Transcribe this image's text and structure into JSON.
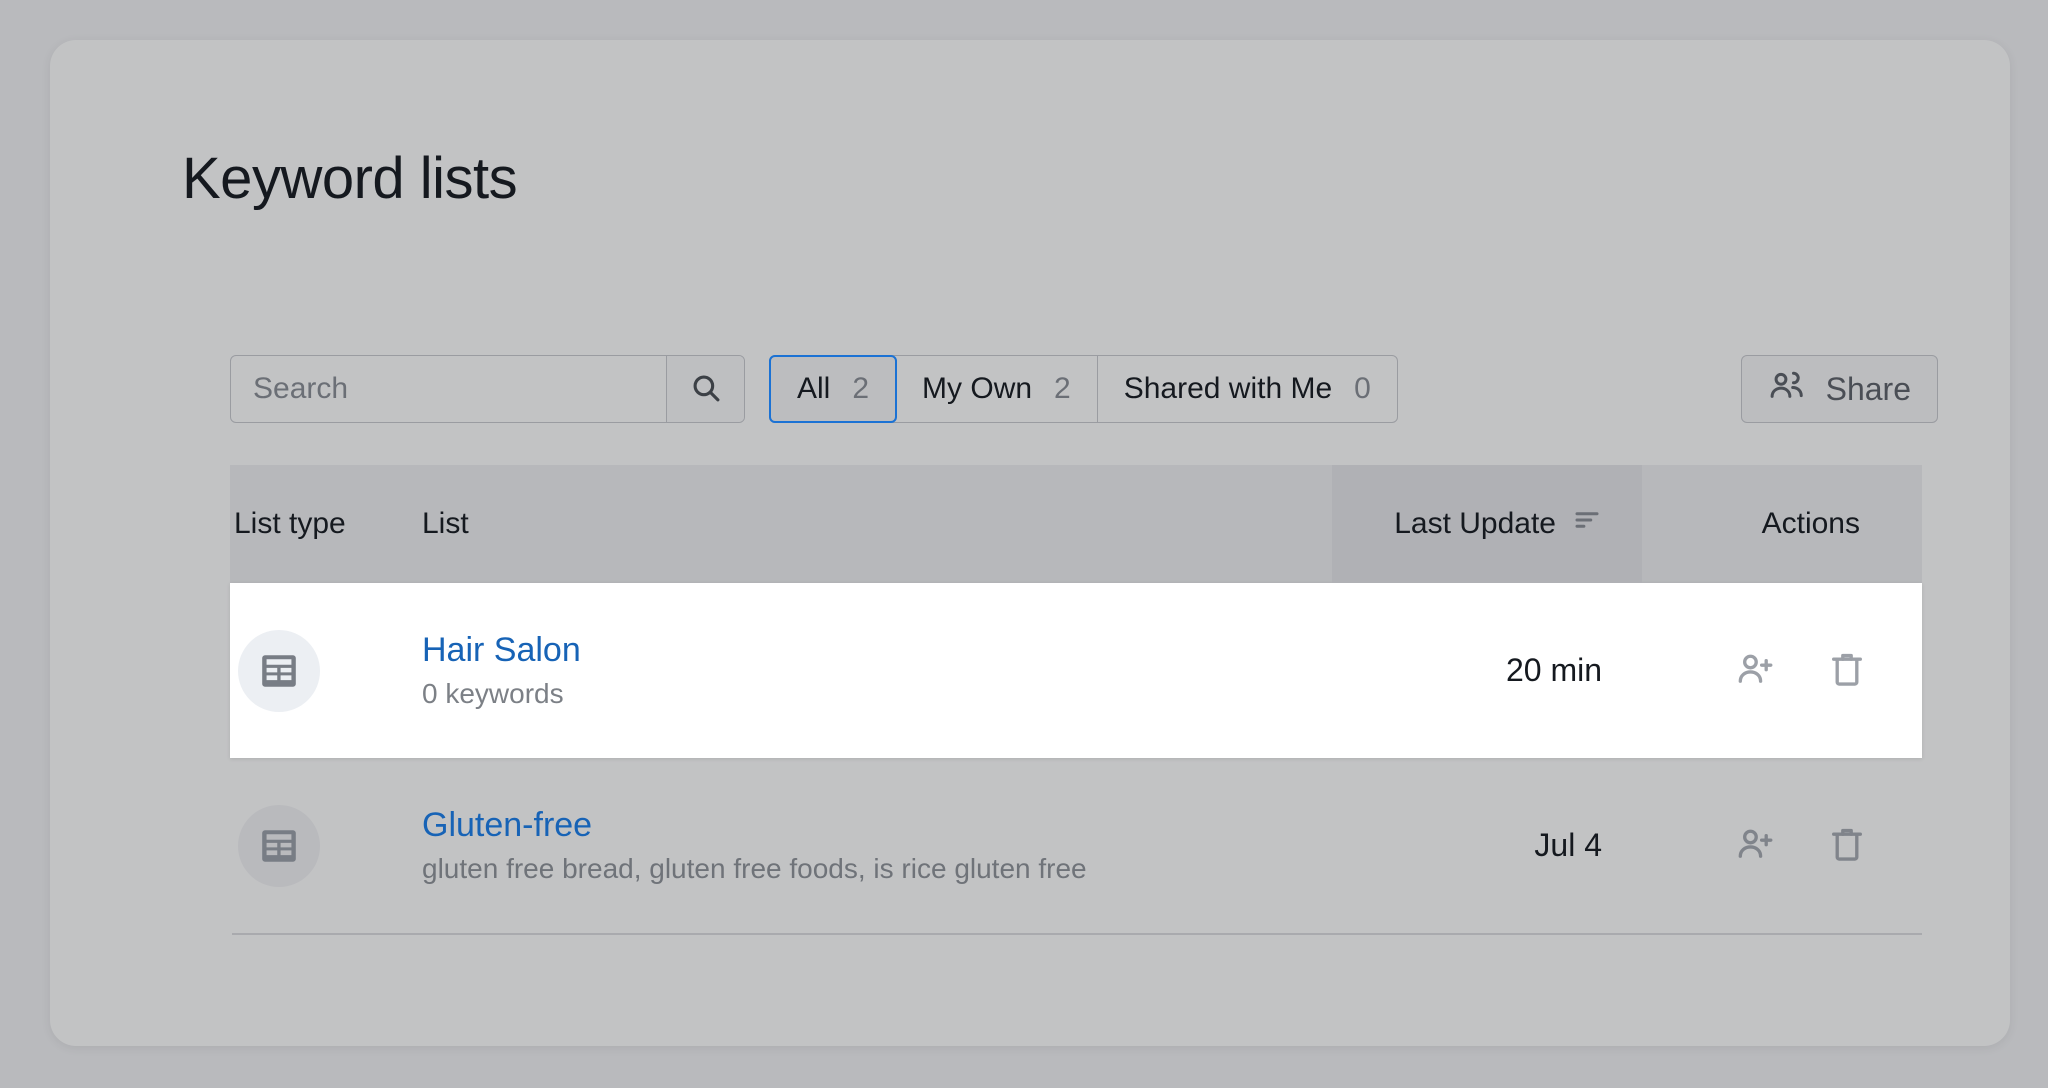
{
  "page": {
    "title": "Keyword lists"
  },
  "search": {
    "placeholder": "Search",
    "value": "",
    "icon": "search-icon"
  },
  "filters": {
    "tabs": [
      {
        "label": "All",
        "count": "2",
        "active": true
      },
      {
        "label": "My Own",
        "count": "2",
        "active": false
      },
      {
        "label": "Shared with Me",
        "count": "0",
        "active": false
      }
    ],
    "active_accent_color": "#1b72d4"
  },
  "share_button": {
    "label": "Share",
    "icon": "people-share-icon"
  },
  "table": {
    "columns": {
      "type": "List type",
      "list": "List",
      "update": "Last Update",
      "actions": "Actions"
    },
    "sort_icon": "sort-descending-icon",
    "rows": [
      {
        "type_icon": "table-list-icon",
        "name": "Hair Salon",
        "keywords": "0 keywords",
        "last_update": "20 min",
        "highlighted": true,
        "actions": {
          "share": "person-add-icon",
          "delete": "trash-icon"
        }
      },
      {
        "type_icon": "table-list-icon",
        "name": "Gluten-free",
        "keywords": "gluten free bread, gluten free foods, is rice gluten free",
        "last_update": "Jul 4",
        "highlighted": false,
        "actions": {
          "share": "person-add-icon",
          "delete": "trash-icon"
        }
      }
    ]
  },
  "colors": {
    "link": "#1763b6",
    "background": "#c2c3c4",
    "highlight_row": "#ffffff"
  }
}
